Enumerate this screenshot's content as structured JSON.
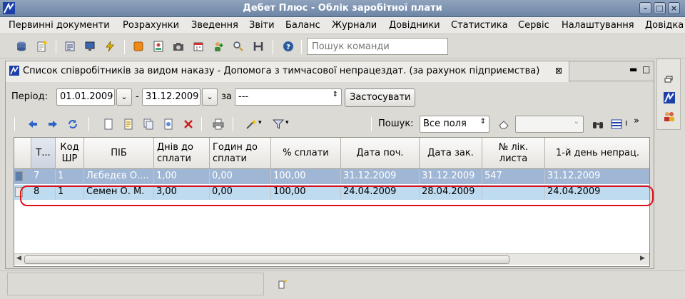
{
  "window": {
    "title": "Дебет Плюс - Облік заробітної плати"
  },
  "menu": [
    "Первинні документи",
    "Розрахунки",
    "Зведення",
    "Звіти",
    "Баланс",
    "Журнали",
    "Довідники",
    "Статистика",
    "Сервіс",
    "Налаштування",
    "Довідка"
  ],
  "toolbar": {
    "command_search_placeholder": "Пошук команди"
  },
  "panel": {
    "title": "Список співробітників за видом наказу - Допомога з тимчасової непрацездат. (за рахунок підприємства)",
    "close_glyph": "⊠"
  },
  "filter": {
    "period_label": "Період:",
    "date_from": "01.01.2009",
    "dash": "-",
    "date_to": "31.12.2009",
    "for_label": "за",
    "for_value": "---",
    "apply_button": "Застосувати"
  },
  "search": {
    "label": "Пошук:",
    "scope_value": "Все поля",
    "query_value": ""
  },
  "grid": {
    "columns": [
      "Т...",
      "Код ШР",
      "ПІБ",
      "Днів до сплати",
      "Годин до сплати",
      "% сплати",
      "Дата поч.",
      "Дата зак.",
      "№ лік. листа",
      "1-й день непрац."
    ],
    "rows": [
      {
        "t": "7",
        "code": "1",
        "name": "Лєбедєв О....",
        "days": "1,00",
        "hours": "0,00",
        "pct": "100,00",
        "start": "31.12.2009",
        "end": "31.12.2009",
        "sick": "547",
        "first": "31.12.2009"
      },
      {
        "t": "8",
        "code": "1",
        "name": "Семен О. М.",
        "days": "3,00",
        "hours": "0,00",
        "pct": "100,00",
        "start": "24.04.2009",
        "end": "28.04.2009",
        "sick": "",
        "first": "24.04.2009"
      }
    ]
  },
  "colors": {
    "selected_row": "#9fb6d5",
    "current_row": "#bedbef",
    "highlight": "#e0101a",
    "titlebar": "#7b91b1"
  }
}
